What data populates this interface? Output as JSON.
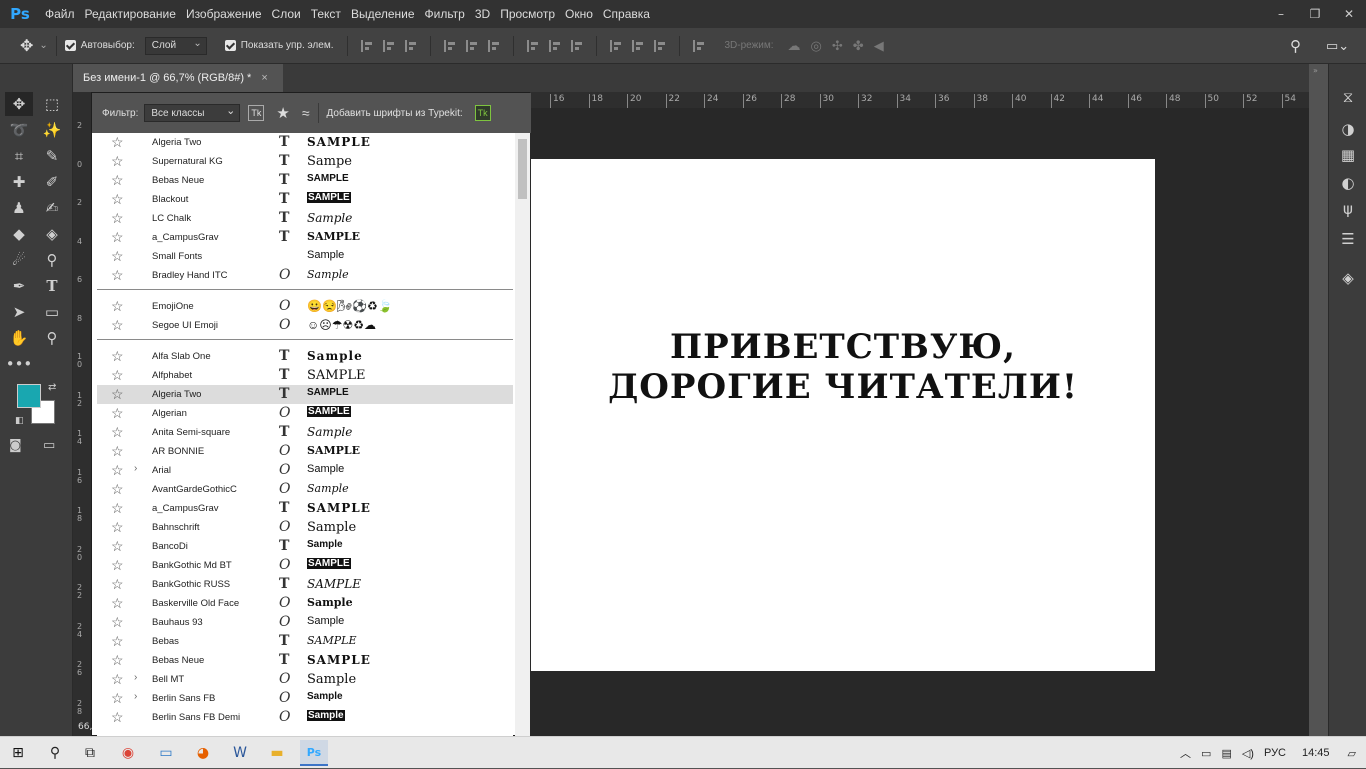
{
  "app": {
    "logo": "Ps"
  },
  "menu": [
    "Файл",
    "Редактирование",
    "Изображение",
    "Слои",
    "Текст",
    "Выделение",
    "Фильтр",
    "3D",
    "Просмотр",
    "Окно",
    "Справка"
  ],
  "window_controls": [
    "–",
    "❐",
    "✕"
  ],
  "options": {
    "autoselect_label": "Автовыбор:",
    "autoselect_value": "Слой",
    "show_controls_label": "Показать упр. элем.",
    "mode_3d_label": "3D-режим:"
  },
  "document_tab": {
    "title": "Без имени-1 @ 66,7% (RGB/8#) *",
    "close": "×"
  },
  "font_panel": {
    "filter_label": "Фильтр:",
    "filter_value": "Все классы",
    "tk_label": "Tk",
    "typekit_label": "Добавить шрифты из Typekit:",
    "recent": [
      {
        "name": "Algeria Two",
        "type": "T",
        "sample": "SAMPLE"
      },
      {
        "name": "Supernatural KG",
        "type": "T",
        "sample": "Samре"
      },
      {
        "name": "Bebas Neue",
        "type": "T",
        "sample": "SAMPLE"
      },
      {
        "name": "Blackout",
        "type": "T",
        "sample": "SAMPLE"
      },
      {
        "name": "LC Chalk",
        "type": "T",
        "sample": "Sample"
      },
      {
        "name": "a_CampusGrav",
        "type": "T",
        "sample": "SAMPLE"
      },
      {
        "name": "Small Fonts",
        "type": "",
        "sample": "Sample"
      },
      {
        "name": "Bradley Hand ITC",
        "type": "O",
        "sample": "Sample"
      }
    ],
    "emoji": [
      {
        "name": "EmojiOne",
        "type": "O",
        "sample": "😀😒🌬⚽♻🍃"
      },
      {
        "name": "Segoe UI Emoji",
        "type": "O",
        "sample": "☺☹☂☢♻☁"
      }
    ],
    "all": [
      {
        "name": "Alfa Slab One",
        "type": "T",
        "sample": "Sample",
        "chev": ""
      },
      {
        "name": "Alfphabet",
        "type": "T",
        "sample": "SAMPLE",
        "chev": ""
      },
      {
        "name": "Algeria Two",
        "type": "T",
        "sample": "SAMPLE",
        "chev": "",
        "hl": true
      },
      {
        "name": "Algerian",
        "type": "O",
        "sample": "SAMPLE",
        "chev": ""
      },
      {
        "name": "Anita  Semi-square",
        "type": "T",
        "sample": "Sample",
        "chev": ""
      },
      {
        "name": "AR BONNIE",
        "type": "O",
        "sample": "SAMPLE",
        "chev": ""
      },
      {
        "name": "Arial",
        "type": "O",
        "sample": "Sample",
        "chev": "›"
      },
      {
        "name": "AvantGardeGothicC",
        "type": "O",
        "sample": "Sample",
        "chev": ""
      },
      {
        "name": "a_CampusGrav",
        "type": "T",
        "sample": "SAMPLE",
        "chev": ""
      },
      {
        "name": "Bahnschrift",
        "type": "O",
        "sample": "Sample",
        "chev": ""
      },
      {
        "name": "BancoDi",
        "type": "T",
        "sample": "Sample",
        "chev": ""
      },
      {
        "name": "BankGothic Md BT",
        "type": "O",
        "sample": "SAMPLE",
        "chev": ""
      },
      {
        "name": "BankGothic RUSS",
        "type": "T",
        "sample": "SAMPLE",
        "chev": ""
      },
      {
        "name": "Baskerville Old Face",
        "type": "O",
        "sample": "Sample",
        "chev": ""
      },
      {
        "name": "Bauhaus 93",
        "type": "O",
        "sample": "Sample",
        "chev": ""
      },
      {
        "name": "Bebas",
        "type": "T",
        "sample": "SAMPLE",
        "chev": ""
      },
      {
        "name": "Bebas Neue",
        "type": "T",
        "sample": "SAMPLE",
        "chev": ""
      },
      {
        "name": "Bell MT",
        "type": "O",
        "sample": "Sample",
        "chev": "›"
      },
      {
        "name": "Berlin Sans FB",
        "type": "O",
        "sample": "Sample",
        "chev": "›"
      },
      {
        "name": "Berlin Sans FB Demi",
        "type": "O",
        "sample": "Sample",
        "chev": ""
      }
    ]
  },
  "ruler_h": [
    "16",
    "18",
    "20",
    "22",
    "24",
    "26",
    "28",
    "30",
    "32",
    "34",
    "36",
    "38",
    "40",
    "42",
    "44",
    "46",
    "48",
    "50",
    "52",
    "54"
  ],
  "ruler_v": [
    "2",
    "0",
    "2",
    "4",
    "6",
    "8",
    "1 0",
    "1 2",
    "1 4",
    "1 6",
    "1 8",
    "2 0",
    "2 2",
    "2 4",
    "2 6",
    "2 8"
  ],
  "zoom_label": "66,",
  "canvas": {
    "line1": "ПРИВЕТСТВУЮ,",
    "line2": "ДОРОГИЕ ЧИТАТЕЛИ!"
  },
  "colors": {
    "foreground": "#19a7b0",
    "background": "#ffffff"
  },
  "taskbar": {
    "lang": "РУС",
    "time": "14:45"
  }
}
